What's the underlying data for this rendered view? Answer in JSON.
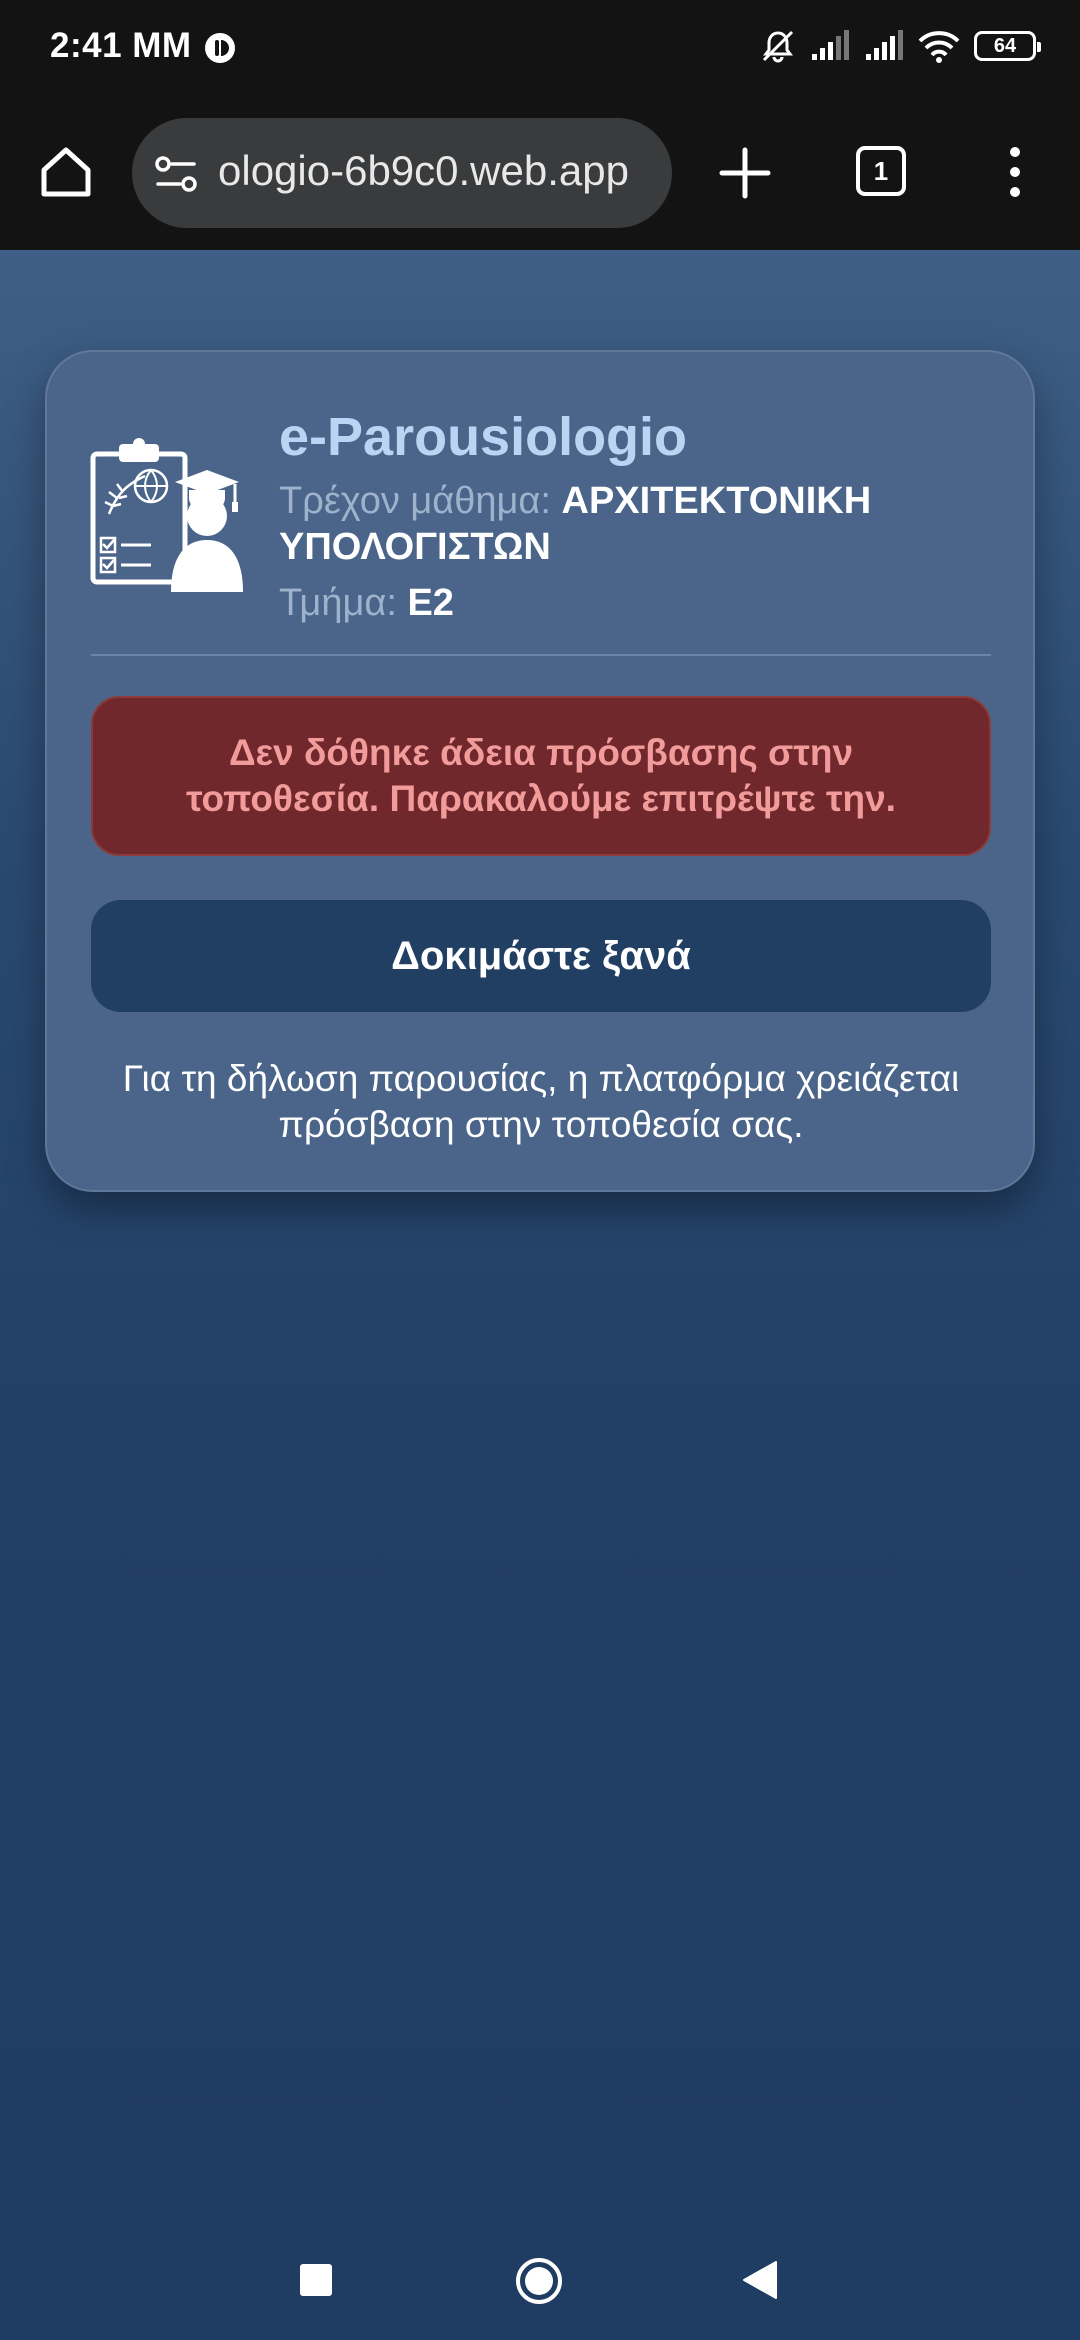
{
  "status_bar": {
    "time": "2:41 MM",
    "battery_level": "64",
    "icons": [
      "app-notification-icon",
      "mute-icon",
      "signal-icon",
      "signal-icon",
      "wifi-icon",
      "battery-icon"
    ]
  },
  "browser": {
    "url": "ologio-6b9c0.web.app",
    "tab_count": "1",
    "icons": [
      "home-icon",
      "site-settings-icon",
      "plus-icon",
      "more-vert-icon"
    ]
  },
  "card": {
    "title": "e-Parousiologio",
    "course_label": "Τρέχον μάθημα:",
    "course_value": "ΑΡΧΙΤΕΚΤΟΝΙΚΗ ΥΠΟΛΟΓΙΣΤΩΝ",
    "dept_label": "Τμήμα:",
    "dept_value": "Ε2",
    "error_message": "Δεν δόθηκε άδεια πρόσβασης στην τοποθεσία. Παρακαλούμε επιτρέψτε την.",
    "retry_label": "Δοκιμάστε ξανά",
    "info_text": "Για τη δήλωση παρουσίας, η πλατφόρμα χρειάζεται πρόσβαση στην τοποθεσία σας."
  },
  "colors": {
    "title": "#bad4f4",
    "card_bg": "#4a6589",
    "error_bg": "#70282c",
    "error_text": "#f29b9b",
    "button_bg": "#213e63"
  }
}
